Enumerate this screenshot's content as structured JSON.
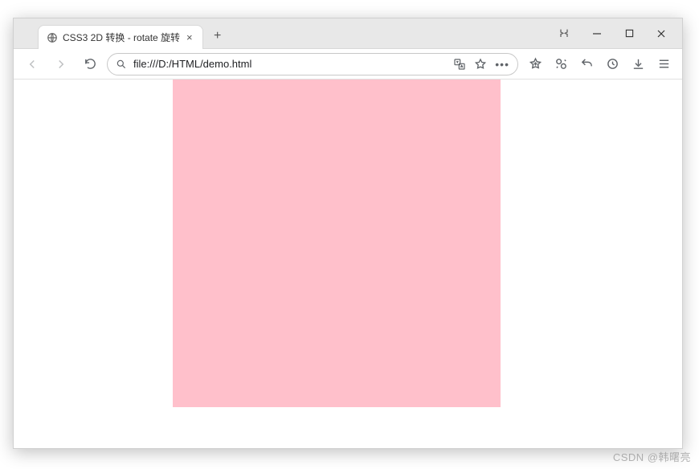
{
  "window": {
    "tab_title": "CSS3 2D 转换 - rotate 旋转",
    "new_tab_label": "+",
    "close_label": "×"
  },
  "address": {
    "url": "file:///D:/HTML/demo.html"
  },
  "content": {
    "box_color": "#ffc0cb"
  },
  "watermark": "CSDN @韩曙亮"
}
